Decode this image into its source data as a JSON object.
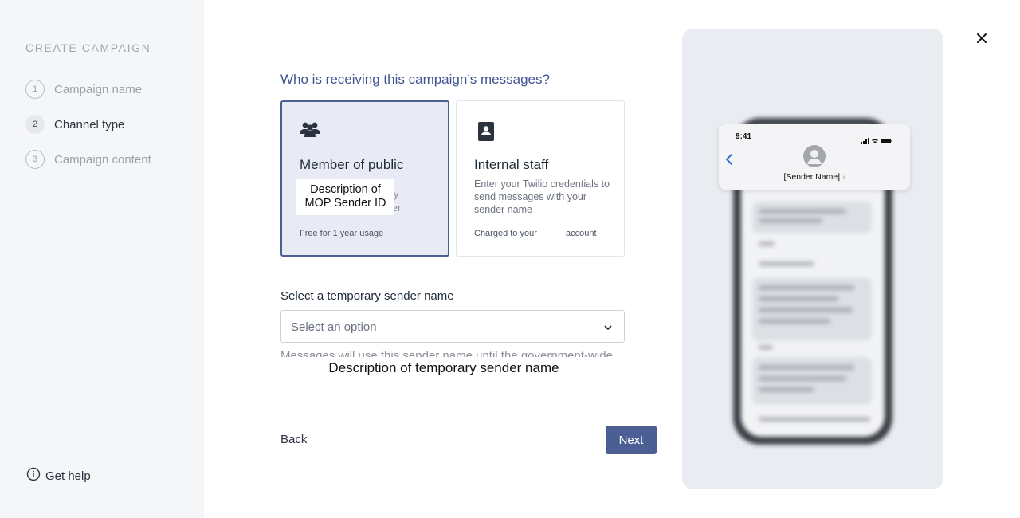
{
  "sidebar": {
    "title": "CREATE CAMPAIGN",
    "steps": [
      {
        "num": "1",
        "label": "Campaign name"
      },
      {
        "num": "2",
        "label": "Channel type"
      },
      {
        "num": "3",
        "label": "Campaign content"
      }
    ],
    "help_label": "Get help"
  },
  "main": {
    "question": "Who is receiving this campaign’s messages?",
    "cards": [
      {
        "icon": "people-group-icon",
        "title": "Member of public",
        "overlay": "Description of MOP Sender ID",
        "ghost_1": "y",
        "ghost_2": "er",
        "footer": "Free for 1 year usage",
        "selected": true
      },
      {
        "icon": "contact-badge-icon",
        "title": "Internal staff",
        "description": "Enter your Twilio credentials to send messages with your sender name",
        "footer_left": "Charged to your",
        "footer_right": "account",
        "selected": false
      }
    ],
    "sender_label": "Select a temporary sender name",
    "select_placeholder": "Select an option",
    "clipped_text": "Messages will use this sender name until the government-wide",
    "overlay_description": "Description of temporary sender name",
    "back_label": "Back",
    "next_label": "Next"
  },
  "preview": {
    "time": "9:41",
    "sender_name": "[Sender Name]",
    "sender_chevron": "›"
  },
  "colors": {
    "accent": "#4b5f94",
    "question": "#3e5590",
    "sidebar_bg": "#f5f6f8",
    "preview_bg": "#e9ecf1"
  }
}
